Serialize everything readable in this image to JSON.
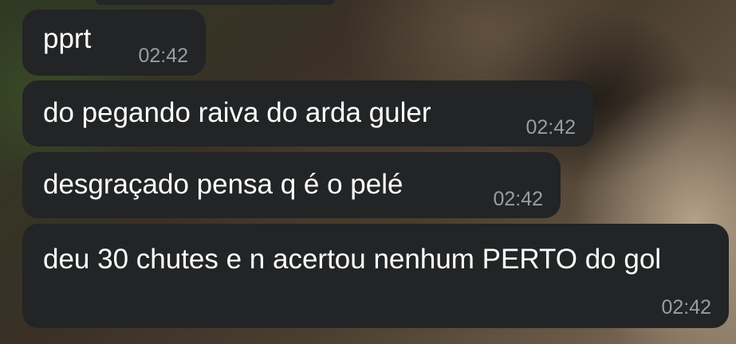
{
  "chat": {
    "messages": [
      {
        "text": "pprt",
        "time": "02:42"
      },
      {
        "text": "do pegando raiva do arda guler",
        "time": "02:42"
      },
      {
        "text": "desgraçado pensa q é o pelé",
        "time": "02:42"
      },
      {
        "text": "deu 30 chutes e n acertou nenhum PERTO do gol",
        "time": "02:42"
      }
    ]
  },
  "colors": {
    "bubble_background": "#222425",
    "message_text": "#ffffff",
    "timestamp_text": "#9a9d9f"
  }
}
